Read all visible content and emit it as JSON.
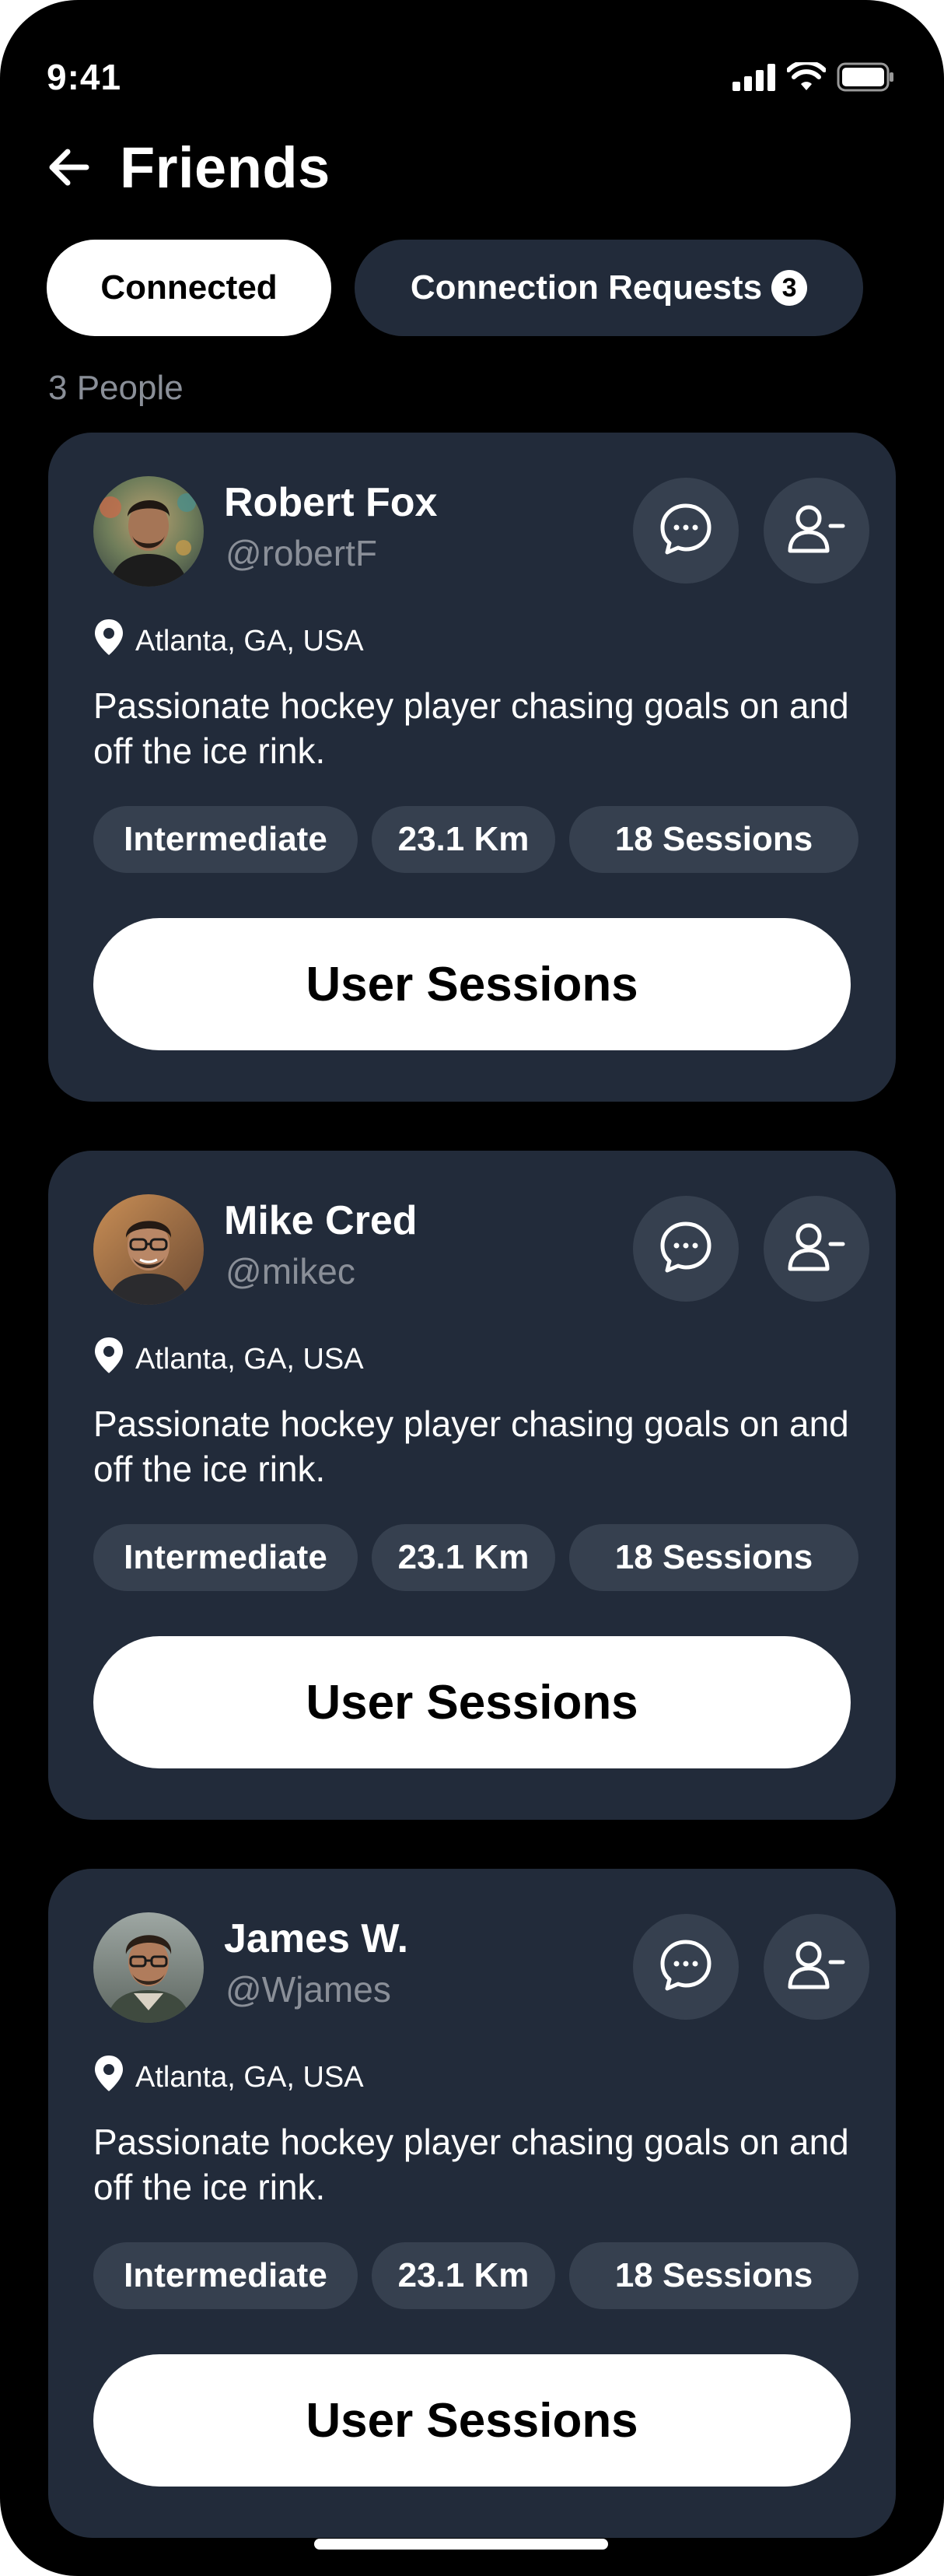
{
  "status_bar": {
    "time": "9:41"
  },
  "header": {
    "title": "Friends"
  },
  "tabs": {
    "connected": "Connected",
    "requests": "Connection Requests",
    "requests_count": "3"
  },
  "people_count": "3 People",
  "colors": {
    "background": "#000000",
    "card": "#222b3a",
    "chip": "#36404f",
    "muted_text": "#8a8f98",
    "primary_button": "#ffffff"
  },
  "friends": [
    {
      "name": "Robert Fox",
      "handle": "@robertF",
      "location": "Atlanta, GA, USA",
      "bio": "Passionate hockey player chasing goals on and off the ice rink.",
      "level": "Intermediate",
      "distance": "23.1 Km",
      "sessions": "18 Sessions",
      "button": "User Sessions"
    },
    {
      "name": "Mike Cred",
      "handle": "@mikec",
      "location": "Atlanta, GA, USA",
      "bio": "Passionate hockey player chasing goals on and off the ice rink.",
      "level": "Intermediate",
      "distance": "23.1 Km",
      "sessions": "18 Sessions",
      "button": "User Sessions"
    },
    {
      "name": "James W.",
      "handle": "@Wjames",
      "location": "Atlanta, GA, USA",
      "bio": "Passionate hockey player chasing goals on and off the ice rink.",
      "level": "Intermediate",
      "distance": "23.1 Km",
      "sessions": "18 Sessions",
      "button": "User Sessions"
    }
  ],
  "icons": {
    "back": "arrow-left-icon",
    "message": "chat-bubble-icon",
    "remove": "remove-friend-icon",
    "location": "location-pin-icon",
    "signal": "signal-icon",
    "wifi": "wifi-icon",
    "battery": "battery-icon"
  }
}
